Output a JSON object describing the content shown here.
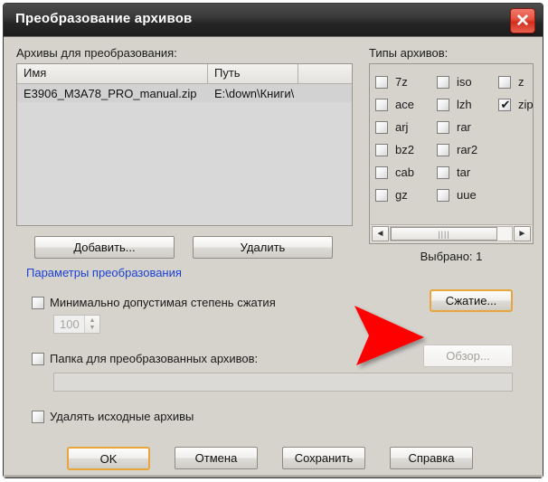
{
  "window": {
    "title": "Преобразование архивов",
    "close_icon": "close-icon"
  },
  "archives": {
    "section_label": "Архивы для преобразования:",
    "columns": [
      "Имя",
      "Путь",
      ""
    ],
    "rows": [
      {
        "name": "E3906_M3A78_PRO_manual.zip",
        "path": "E:\\down\\Книги\\"
      }
    ],
    "add_button": "Добавить...",
    "delete_button": "Удалить"
  },
  "types": {
    "section_label": "Типы архивов:",
    "columns": [
      [
        {
          "label": "7z",
          "checked": false
        },
        {
          "label": "ace",
          "checked": false
        },
        {
          "label": "arj",
          "checked": false
        },
        {
          "label": "bz2",
          "checked": false
        },
        {
          "label": "cab",
          "checked": false
        },
        {
          "label": "gz",
          "checked": false
        }
      ],
      [
        {
          "label": "iso",
          "checked": false
        },
        {
          "label": "lzh",
          "checked": false
        },
        {
          "label": "rar",
          "checked": false
        },
        {
          "label": "rar2",
          "checked": false
        },
        {
          "label": "tar",
          "checked": false
        },
        {
          "label": "uue",
          "checked": false
        }
      ],
      [
        {
          "label": "z",
          "checked": false
        },
        {
          "label": "zip",
          "checked": true
        }
      ]
    ],
    "scroll_left_icon": "chevron-left-icon",
    "scroll_right_icon": "chevron-right-icon",
    "scroll_grip": "||||",
    "selected_count": "Выбрано: 1"
  },
  "params": {
    "link_label": "Параметры преобразования",
    "link_color": "#1a3fd4",
    "min_ratio": {
      "label": "Минимально допустимая степень сжатия",
      "checked": false,
      "value": "100",
      "enabled": false
    },
    "compress_button": "Сжатие...",
    "output_folder": {
      "label": "Папка для преобразованных архивов:",
      "checked": false,
      "browse_button": "Обзор...",
      "path_value": "",
      "enabled": false
    },
    "delete_source": {
      "label": "Удалять исходные архивы",
      "checked": false
    }
  },
  "footer": {
    "ok": "OK",
    "cancel": "Отмена",
    "save": "Сохранить",
    "help": "Справка"
  },
  "annotation": {
    "arrow_color": "#ff0000",
    "points_to": "Сжатие..."
  }
}
